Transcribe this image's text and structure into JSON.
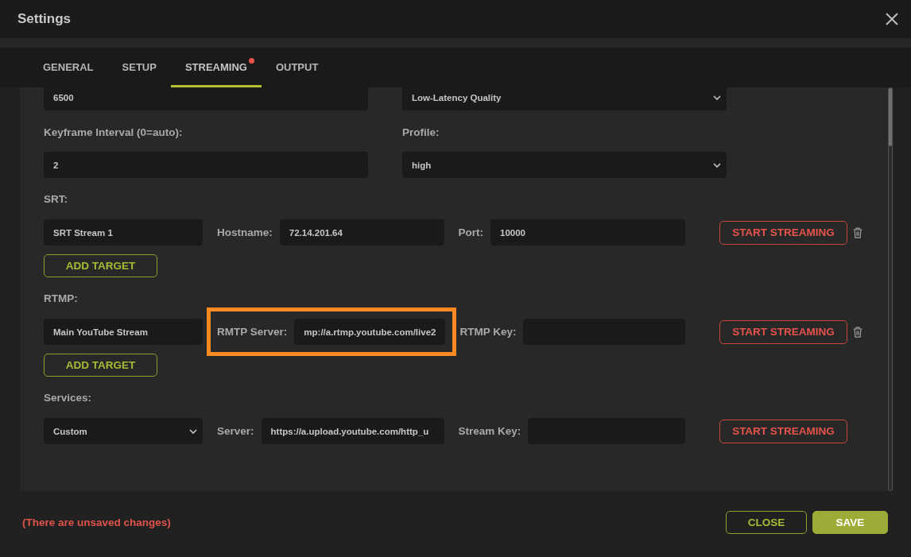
{
  "window": {
    "title": "Settings"
  },
  "tabs": [
    {
      "label": "GENERAL",
      "selected": false,
      "dot": false
    },
    {
      "label": "SETUP",
      "selected": false,
      "dot": false
    },
    {
      "label": "STREAMING",
      "selected": true,
      "dot": true
    },
    {
      "label": "OUTPUT",
      "selected": false,
      "dot": false
    }
  ],
  "encoder": [
    {
      "kind": "input",
      "value": "6500"
    },
    {
      "kind": "select",
      "value": "Low-Latency Quality"
    },
    {
      "kind": "input",
      "label": "Keyframe Interval (0=auto):",
      "value": "2"
    },
    {
      "kind": "select",
      "label": "Profile:",
      "value": "high"
    }
  ],
  "stream_sections": [
    {
      "label": "SRT:",
      "rows": [
        {
          "fields": [
            {
              "kind": "input",
              "value": "SRT Stream 1",
              "highlighted": false
            },
            {
              "kind": "input",
              "label": "Hostname:",
              "value": "72.14.201.64",
              "highlighted": false
            },
            {
              "kind": "input",
              "label": "Port:",
              "value": "10000",
              "highlighted": false
            }
          ],
          "action": "START STREAMING",
          "deletable": true
        }
      ],
      "add_button": "ADD TARGET"
    },
    {
      "label": "RTMP:",
      "rows": [
        {
          "fields": [
            {
              "kind": "input",
              "value": "Main YouTube Stream",
              "highlighted": false
            },
            {
              "kind": "input",
              "label": "RMTP Server:",
              "value": "mp://a.rtmp.youtube.com/live2",
              "highlighted": true
            },
            {
              "kind": "input",
              "label": "RTMP Key:",
              "highlighted": false
            }
          ],
          "action": "START STREAMING",
          "deletable": true
        }
      ],
      "add_button": "ADD TARGET"
    },
    {
      "label": "Services:",
      "rows": [
        {
          "fields": [
            {
              "kind": "select",
              "value": "Custom",
              "highlighted": false
            },
            {
              "kind": "input",
              "label": "Server:",
              "value": "https://a.upload.youtube.com/http_u",
              "highlighted": false
            },
            {
              "kind": "input",
              "label": "Stream Key:",
              "highlighted": false
            }
          ],
          "action": "START STREAMING",
          "deletable": false
        }
      ]
    }
  ],
  "footer": {
    "message": "(There are unsaved changes)",
    "buttons": [
      {
        "label": "CLOSE",
        "kind": "secondary"
      },
      {
        "label": "SAVE",
        "kind": "primary"
      }
    ]
  }
}
